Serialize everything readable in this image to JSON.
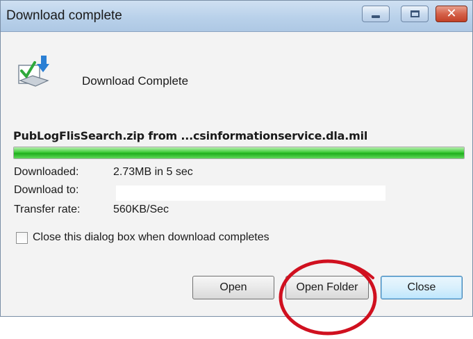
{
  "window": {
    "title": "Download complete",
    "controls": {
      "minimize_icon": "minimize-icon",
      "maximize_icon": "maximize-icon",
      "close_glyph": "✕"
    }
  },
  "status": {
    "icon": "download-complete-icon",
    "heading": "Download Complete"
  },
  "file": {
    "description": "PubLogFlisSearch.zip from ...csinformationservice.dla.mil"
  },
  "progress": {
    "percent": 100
  },
  "details": [
    {
      "label": "Downloaded:",
      "value": "2.73MB in 5 sec"
    },
    {
      "label": "Download to:",
      "value": ""
    },
    {
      "label": "Transfer rate:",
      "value": "560KB/Sec"
    }
  ],
  "options": {
    "close_on_complete_label": "Close this dialog box when download completes",
    "close_on_complete_checked": false
  },
  "buttons": {
    "open": "Open",
    "open_folder": "Open Folder",
    "close": "Close"
  },
  "colors": {
    "progress_green": "#1fae1c",
    "highlight_ring": "#d0101f",
    "titlebar": "#b9d1ea",
    "close_button": "#c24026"
  }
}
